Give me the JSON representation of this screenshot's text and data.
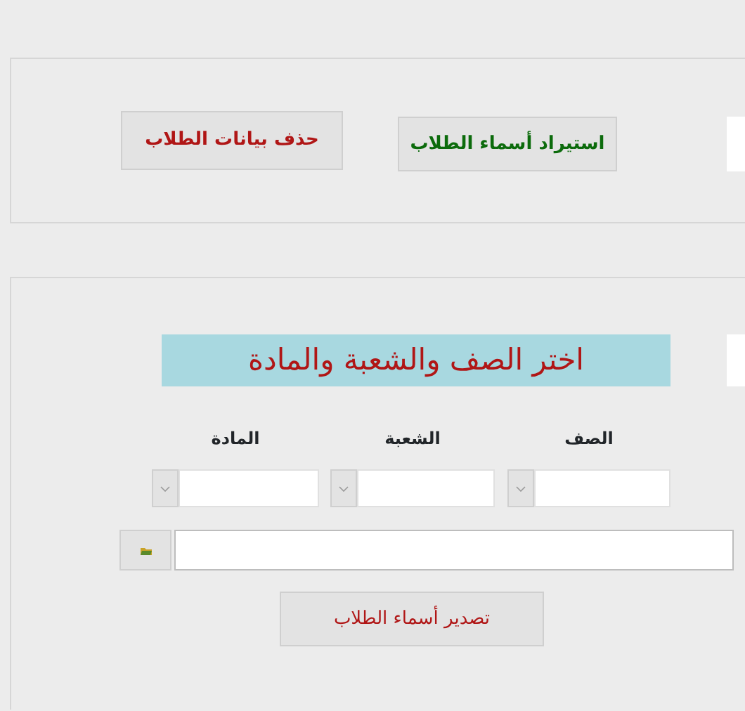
{
  "top_panel": {
    "buttons": [
      {
        "label": "استيراد أسماء الطلاب",
        "kind": "success"
      },
      {
        "label": "حذف بيانات الطلاب",
        "kind": "danger"
      }
    ]
  },
  "selection_panel": {
    "banner": "اختر الصف والشعبة والمادة",
    "combos": [
      {
        "label": "الصف"
      },
      {
        "label": "الشعبة"
      },
      {
        "label": "المادة"
      }
    ],
    "export_button": {
      "label": "تصدير أسماء الطلاب"
    }
  }
}
